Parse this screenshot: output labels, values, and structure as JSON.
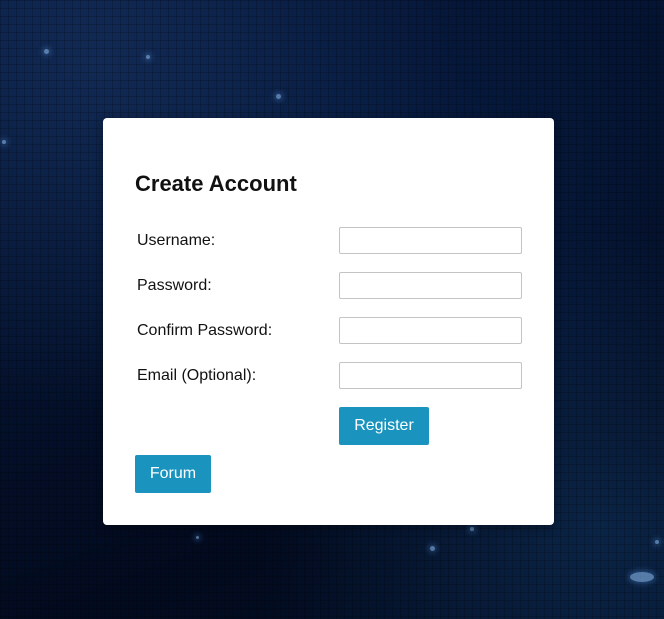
{
  "form": {
    "title": "Create Account",
    "fields": [
      {
        "label": "Username:",
        "value": "",
        "placeholder": ""
      },
      {
        "label": "Password:",
        "value": "",
        "placeholder": ""
      },
      {
        "label": "Confirm Password:",
        "value": "",
        "placeholder": ""
      },
      {
        "label": "Email (Optional):",
        "value": "",
        "placeholder": ""
      }
    ],
    "register_label": "Register",
    "forum_label": "Forum"
  },
  "colors": {
    "accent": "#1a94be",
    "card_background": "#ffffff",
    "page_background": "#04122e"
  }
}
